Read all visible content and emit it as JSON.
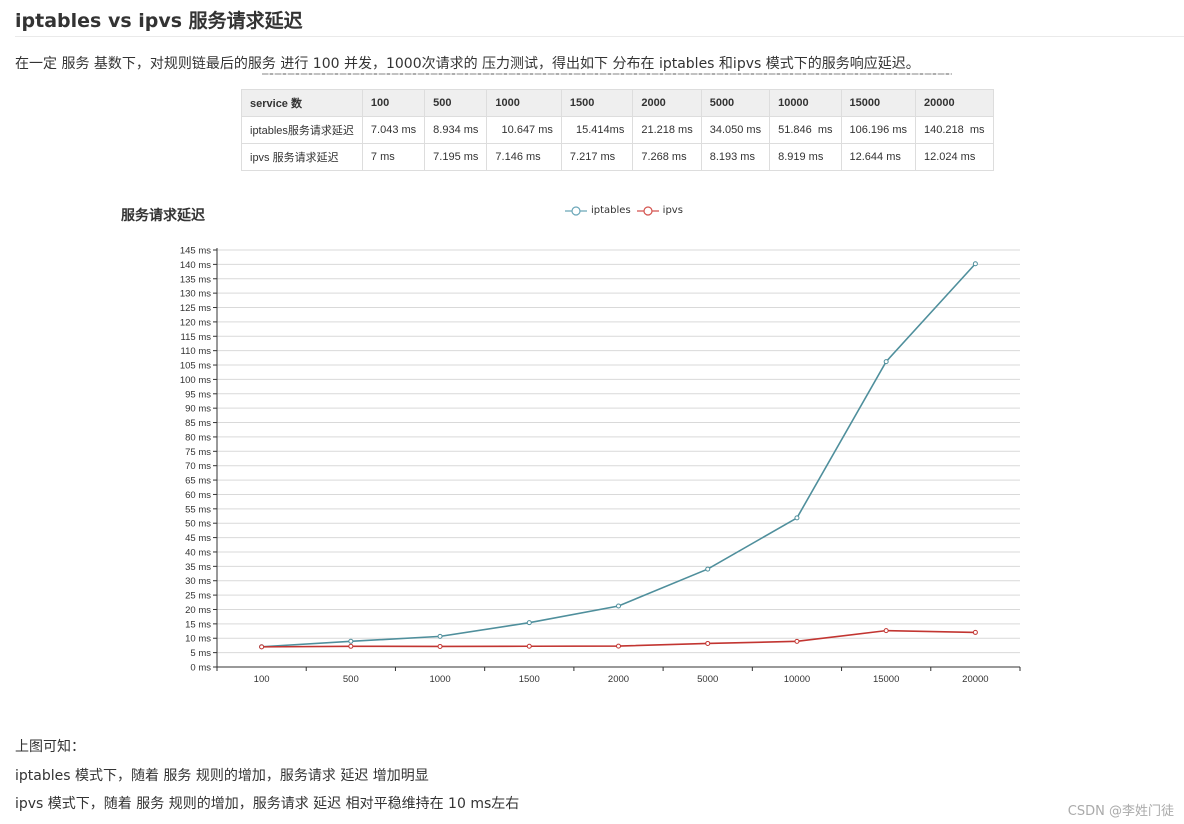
{
  "heading": "iptables vs ipvs 服务请求延迟",
  "intro": "在一定 服务 基数下，对规则链最后的服务 进行 100 并发，1000次请求的 压力测试，得出如下 分布在 iptables 和ipvs 模式下的服务响应延迟。",
  "table": {
    "headers": [
      "service 数",
      "100",
      "500",
      "1000",
      "1500",
      "2000",
      "5000",
      "10000",
      "15000",
      "20000"
    ],
    "rows": [
      [
        "iptables服务请求延迟",
        "7.043 ms",
        "8.934 ms",
        "  10.647 ms",
        "  15.414ms",
        "21.218 ms",
        "34.050 ms",
        "51.846  ms",
        "106.196 ms",
        "140.218  ms"
      ],
      [
        "ipvs 服务请求延迟",
        "7 ms",
        "7.195 ms",
        "7.146 ms",
        "7.217 ms",
        "7.268 ms",
        "8.193 ms",
        "8.919 ms",
        "12.644 ms",
        "12.024 ms"
      ]
    ]
  },
  "chart_data": {
    "type": "line",
    "title": "服务请求延迟",
    "xlabel": "",
    "ylabel": "",
    "categories": [
      "100",
      "500",
      "1000",
      "1500",
      "2000",
      "5000",
      "10000",
      "15000",
      "20000"
    ],
    "series": [
      {
        "name": "iptables",
        "color": "#4f8f9c",
        "values": [
          7.043,
          8.934,
          10.647,
          15.414,
          21.218,
          34.05,
          51.846,
          106.196,
          140.218
        ]
      },
      {
        "name": "ipvs",
        "color": "#c23531",
        "values": [
          7,
          7.195,
          7.146,
          7.217,
          7.268,
          8.193,
          8.919,
          12.644,
          12.024
        ]
      }
    ],
    "ylim": [
      0,
      145
    ],
    "ytick_step": 5,
    "ytick_suffix": " ms",
    "grid": true,
    "legend": "top-center"
  },
  "conclusion": {
    "lead": "上图可知：",
    "lines": [
      "iptables 模式下，随着 服务 规则的增加，服务请求 延迟 增加明显",
      "ipvs 模式下，随着 服务 规则的增加，服务请求 延迟 相对平稳维持在 10 ms左右"
    ]
  },
  "watermark": "CSDN @李姓门徒"
}
